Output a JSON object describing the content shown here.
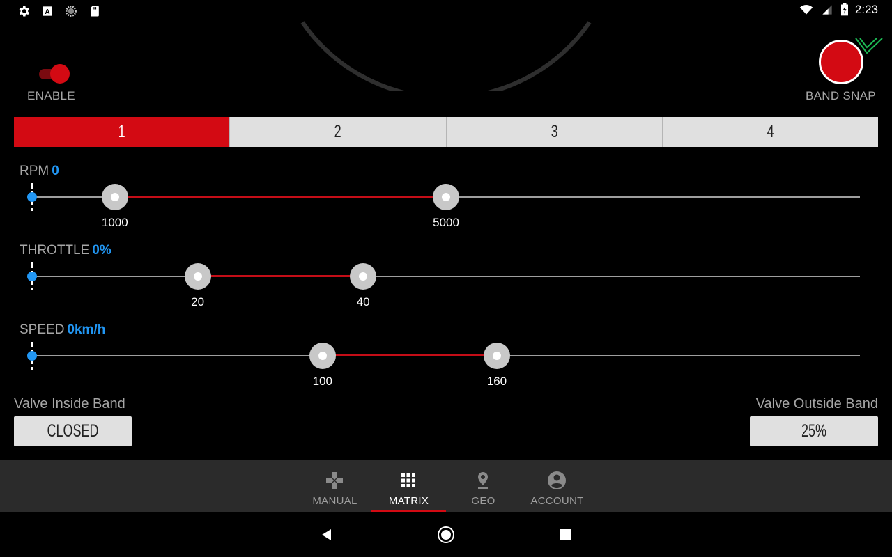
{
  "status_bar": {
    "time": "2:23",
    "left_icons": [
      "settings-icon",
      "a-notification-icon",
      "sync-circle-icon",
      "sd-card-icon"
    ],
    "right_icons": [
      "wifi-icon",
      "signal-icon",
      "battery-charging-icon"
    ]
  },
  "header": {
    "enable_label": "ENABLE",
    "enable_on": true,
    "band_snap_label": "BAND SNAP"
  },
  "bands": {
    "tabs": [
      "1",
      "2",
      "3",
      "4"
    ],
    "active_index": 0
  },
  "rows": {
    "rpm": {
      "label": "RPM",
      "value": "0",
      "low": "1000",
      "high": "5000",
      "min": 0,
      "max": 10000,
      "low_num": 1000,
      "high_num": 5000
    },
    "throttle": {
      "label": "THROTTLE",
      "value": "0%",
      "low": "20",
      "high": "40",
      "min": 0,
      "max": 100,
      "low_num": 20,
      "high_num": 40
    },
    "speed": {
      "label": "SPEED",
      "value": "0km/h",
      "low": "100",
      "high": "160",
      "min": 0,
      "max": 285,
      "low_num": 100,
      "high_num": 160
    }
  },
  "valve": {
    "inside_label": "Valve Inside Band",
    "inside_value": "CLOSED",
    "outside_label": "Valve Outside Band",
    "outside_value": "25%"
  },
  "bottom_nav": {
    "items": [
      {
        "label": "MANUAL",
        "icon": "gamepad-icon"
      },
      {
        "label": "MATRIX",
        "icon": "grid-icon"
      },
      {
        "label": "GEO",
        "icon": "location-pin-icon"
      },
      {
        "label": "ACCOUNT",
        "icon": "account-circle-icon"
      }
    ],
    "active_index": 1
  },
  "colors": {
    "accent_red": "#d30a13",
    "value_blue": "#2196f3",
    "tab_grey": "#e0e0e0"
  }
}
